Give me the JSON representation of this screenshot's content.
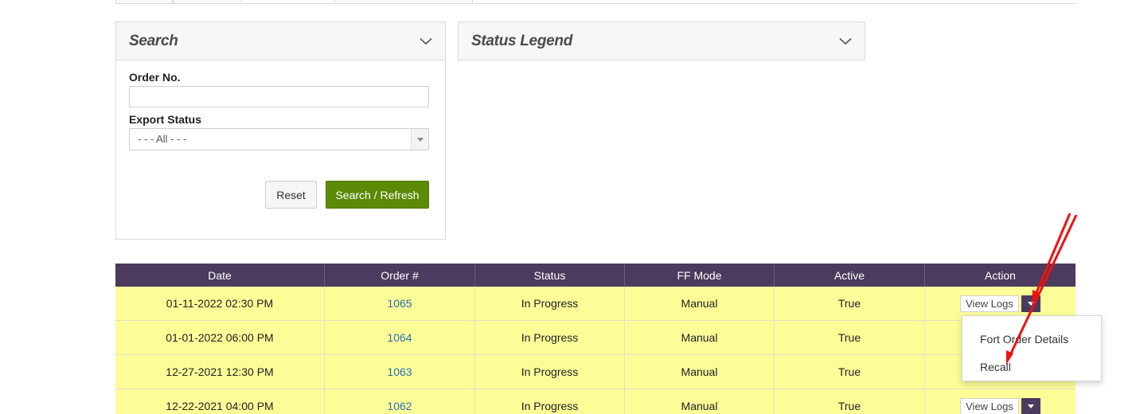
{
  "search_panel": {
    "title": "Search",
    "order_label": "Order No.",
    "order_value": "",
    "export_label": "Export Status",
    "export_selected": "- - - All - - -",
    "reset_label": "Reset",
    "search_label": "Search / Refresh"
  },
  "legend_panel": {
    "title": "Status Legend"
  },
  "table": {
    "headers": [
      "Date",
      "Order #",
      "Status",
      "FF Mode",
      "Active",
      "Action"
    ],
    "rows": [
      {
        "date": "01-11-2022 02:30 PM",
        "order": "1065",
        "status": "In Progress",
        "ff_mode": "Manual",
        "active": "True"
      },
      {
        "date": "01-01-2022 06:00 PM",
        "order": "1064",
        "status": "In Progress",
        "ff_mode": "Manual",
        "active": "True"
      },
      {
        "date": "12-27-2021 12:30 PM",
        "order": "1063",
        "status": "In Progress",
        "ff_mode": "Manual",
        "active": "True"
      },
      {
        "date": "12-22-2021 04:00 PM",
        "order": "1062",
        "status": "In Progress",
        "ff_mode": "Manual",
        "active": "True"
      }
    ],
    "view_logs_label": "View Logs"
  },
  "action_menu": {
    "items": [
      "Fort Order Details",
      "Recall"
    ]
  },
  "colors": {
    "header_bg": "#4b3b5e",
    "row_bg": "#fdfd98",
    "primary_button": "#5b8a06",
    "link": "#2a6eb5",
    "annotation_arrow": "#ee1111"
  },
  "icons": {
    "panel_toggle": "chevron-down-icon",
    "select_toggle": "caret-down-icon",
    "action_toggle": "caret-down-icon"
  }
}
